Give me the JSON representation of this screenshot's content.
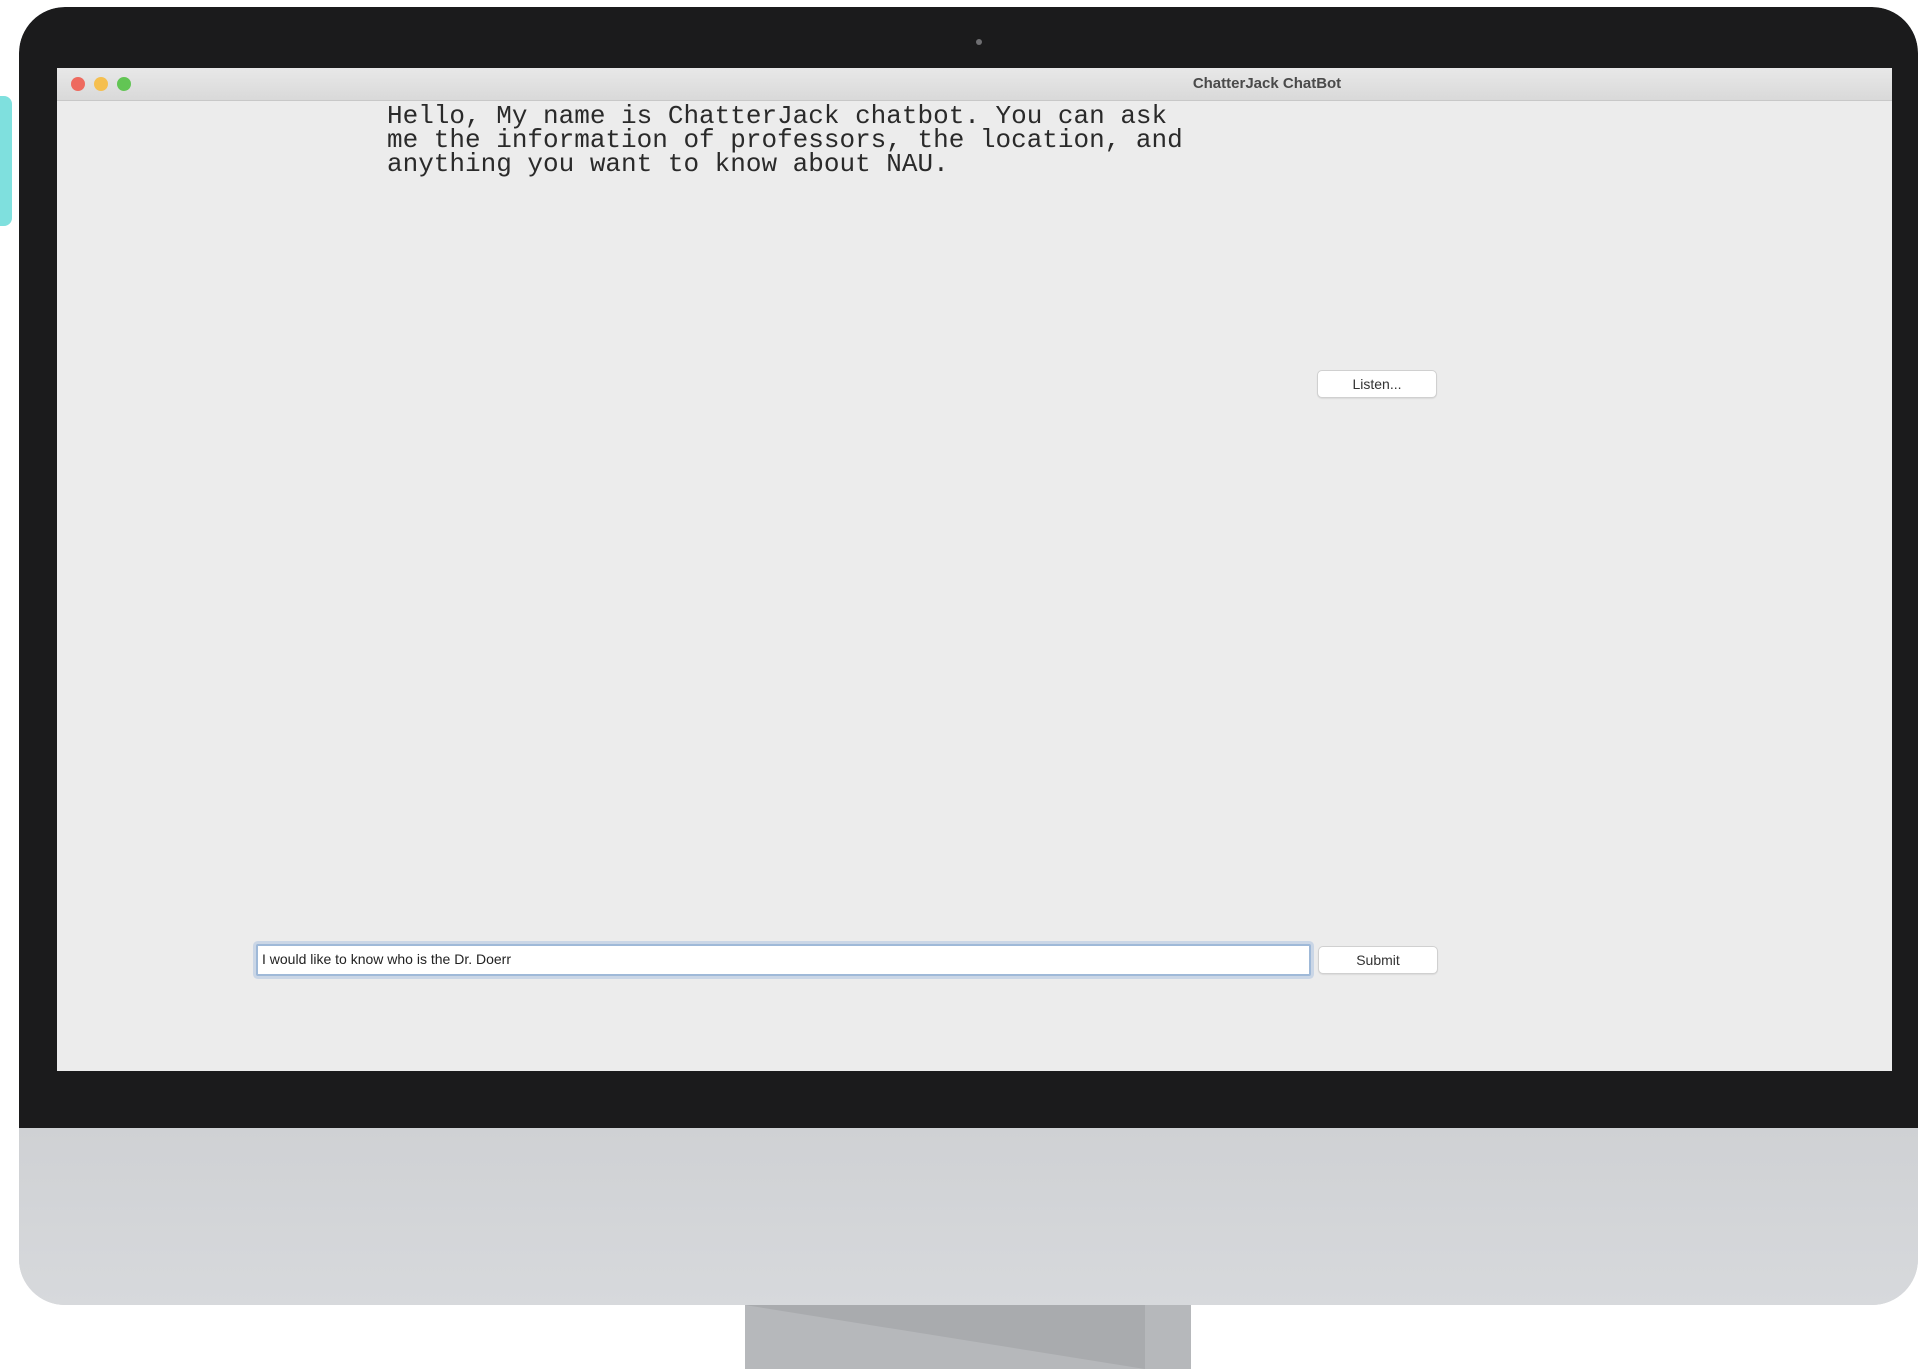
{
  "window": {
    "title": "ChatterJack ChatBot"
  },
  "chat": {
    "message": "Hello, My name is ChatterJack chatbot. You can ask\nme the information of professors, the location, and\nanything you want to know about NAU."
  },
  "controls": {
    "listen_label": "Listen...",
    "submit_label": "Submit",
    "input_value": "I would like to know who is the Dr. Doerr"
  },
  "colors": {
    "window_bg": "#ececec",
    "bezel": "#1b1b1c",
    "close": "#ee6a5f",
    "minimize": "#f5bf4f",
    "maximize": "#62c554"
  }
}
